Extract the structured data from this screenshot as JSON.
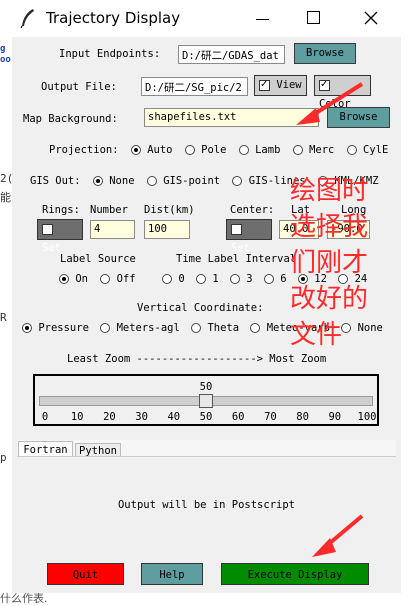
{
  "window": {
    "title": "Trajectory Display"
  },
  "input_endpoints": {
    "label": "Input Endpoints:",
    "value": "D:/研二/GDAS_dat",
    "browse": "Browse"
  },
  "output_file": {
    "label": "Output File:",
    "value": "D:/研二/SG_pic/2",
    "view": "View",
    "color": "Color"
  },
  "map_background": {
    "label": "Map Background:",
    "value": "shapefiles.txt",
    "browse": "Browse"
  },
  "projection": {
    "label": "Projection:",
    "options": [
      "Auto",
      "Pole",
      "Lamb",
      "Merc",
      "CylE"
    ],
    "selected": "Auto"
  },
  "gis_out": {
    "label": "GIS Out:",
    "options": [
      "None",
      "GIS-point",
      "GIS-lines",
      "KML/KMZ"
    ],
    "selected": "None"
  },
  "rings": {
    "label": "Rings:",
    "number_label": "Number",
    "dist_label": "Dist(km)",
    "set": "Set",
    "number": "4",
    "dist": "100"
  },
  "center": {
    "label": "Center:",
    "lat_label": "Lat",
    "lon_label": "Long",
    "set": "Set",
    "lat": "40.0",
    "lon": "-90.0"
  },
  "label_source": {
    "label": "Label Source",
    "options": [
      "On",
      "Off"
    ],
    "selected": "On"
  },
  "time_label": {
    "label": "Time Label Interval",
    "options": [
      "0",
      "1",
      "3",
      "6",
      "12",
      "24"
    ],
    "selected": "12"
  },
  "vertical": {
    "label": "Vertical Coordinate:",
    "options": [
      "Pressure",
      "Meters-agl",
      "Theta",
      "Meteo-varb",
      "None"
    ],
    "selected": "Pressure"
  },
  "zoom": {
    "label": "Least Zoom -------------------> Most Zoom",
    "value": 50,
    "min": 0,
    "max": 100,
    "ticks": [
      "0",
      "10",
      "20",
      "30",
      "40",
      "50",
      "60",
      "70",
      "80",
      "90",
      "100"
    ]
  },
  "tabs": [
    "Fortran",
    "Python"
  ],
  "output_note": "Output will be in Postscript",
  "buttons": {
    "quit": "Quit",
    "help": "Help",
    "execute": "Execute Display"
  },
  "annotation": {
    "text": [
      "绘图时",
      "选择我",
      "们刚才",
      "改好的",
      "文件"
    ]
  },
  "background": {
    "left_lines": [
      "2(",
      "能",
      "R",
      "p"
    ],
    "bottom": "什么作表."
  },
  "colors": {
    "accent": "#5f9ea0",
    "quit": "#ff0000",
    "execute": "#008b00",
    "annotation": "#ff2a2a"
  }
}
